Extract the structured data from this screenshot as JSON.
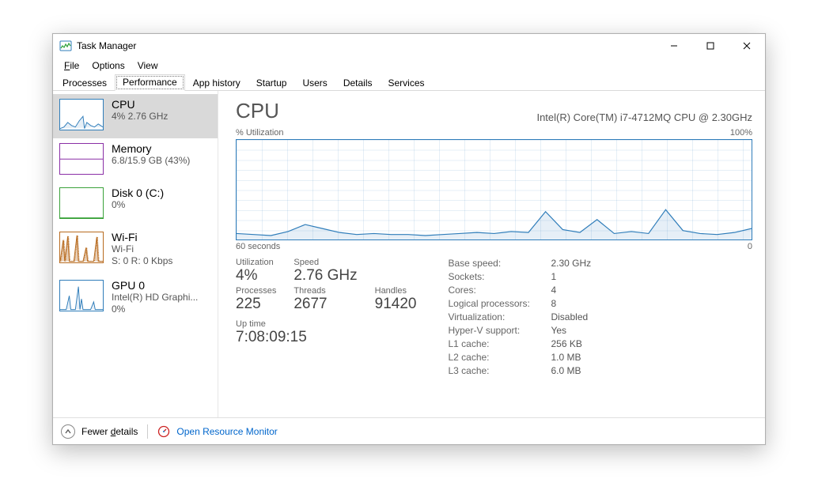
{
  "window": {
    "title": "Task Manager"
  },
  "menus": {
    "file": "File",
    "options": "Options",
    "view": "View"
  },
  "tabs": [
    "Processes",
    "Performance",
    "App history",
    "Startup",
    "Users",
    "Details",
    "Services"
  ],
  "active_tab_index": 1,
  "sidebar": {
    "items": [
      {
        "name": "CPU",
        "title": "CPU",
        "sub": "4% 2.76 GHz",
        "color": "#2f7dba"
      },
      {
        "name": "Memory",
        "title": "Memory",
        "sub": "6.8/15.9 GB (43%)",
        "color": "#8a2fa6"
      },
      {
        "name": "Disk",
        "title": "Disk 0 (C:)",
        "sub": "0%",
        "color": "#3aa23a"
      },
      {
        "name": "WiFi",
        "title": "Wi-Fi",
        "sub": "Wi-Fi",
        "sub2": "S: 0  R: 0 Kbps",
        "color": "#b86b1f"
      },
      {
        "name": "GPU",
        "title": "GPU 0",
        "sub": "Intel(R) HD Graphi...",
        "sub2": "0%",
        "color": "#2f7dba"
      }
    ],
    "selected_index": 0
  },
  "main": {
    "heading": "CPU",
    "subheading": "Intel(R) Core(TM) i7-4712MQ CPU @ 2.30GHz",
    "chart_top_left": "% Utilization",
    "chart_top_right": "100%",
    "chart_bottom_left": "60 seconds",
    "chart_bottom_right": "0",
    "stats": {
      "utilization_label": "Utilization",
      "utilization": "4%",
      "speed_label": "Speed",
      "speed": "2.76 GHz",
      "processes_label": "Processes",
      "processes": "225",
      "threads_label": "Threads",
      "threads": "2677",
      "handles_label": "Handles",
      "handles": "91420",
      "uptime_label": "Up time",
      "uptime": "7:08:09:15"
    },
    "specs": {
      "Base speed:": "2.30 GHz",
      "Sockets:": "1",
      "Cores:": "4",
      "Logical processors:": "8",
      "Virtualization:": "Disabled",
      "Hyper-V support:": "Yes",
      "L1 cache:": "256 KB",
      "L2 cache:": "1.0 MB",
      "L3 cache:": "6.0 MB"
    }
  },
  "footer": {
    "fewer_label_pre": "Fewer ",
    "fewer_label_u": "d",
    "fewer_label_post": "etails",
    "orm_label": "Open Resource Monitor"
  },
  "chart_data": {
    "type": "area",
    "title": "CPU % Utilization",
    "xlabel": "seconds ago",
    "ylabel": "% Utilization",
    "ylim": [
      0,
      100
    ],
    "xlim": [
      60,
      0
    ],
    "x": [
      60,
      58,
      56,
      54,
      52,
      50,
      48,
      46,
      44,
      42,
      40,
      38,
      36,
      34,
      32,
      30,
      28,
      26,
      24,
      22,
      20,
      18,
      16,
      14,
      12,
      10,
      8,
      6,
      4,
      2,
      0
    ],
    "values": [
      6,
      5,
      4,
      8,
      15,
      11,
      7,
      5,
      6,
      5,
      5,
      4,
      5,
      6,
      7,
      6,
      8,
      7,
      28,
      10,
      7,
      20,
      6,
      8,
      6,
      30,
      9,
      6,
      5,
      7,
      11
    ]
  }
}
